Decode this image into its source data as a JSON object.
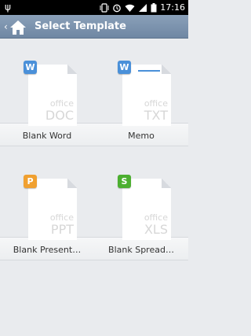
{
  "status_bar": {
    "usb_icon": "usb-debug-icon",
    "time": "17:16"
  },
  "action_bar": {
    "title": "Select Template",
    "home_icon": "home-icon",
    "back_icon": "chevron-left-icon"
  },
  "templates": [
    {
      "label": "Blank Word",
      "badge": "W",
      "badge_color": "#4a90d9",
      "office": "office",
      "ext": "DOC",
      "show_line": false
    },
    {
      "label": "Memo",
      "badge": "W",
      "badge_color": "#4a90d9",
      "office": "office",
      "ext": "TXT",
      "show_line": true
    },
    {
      "label": "Blank Present…",
      "badge": "P",
      "badge_color": "#f0a030",
      "office": "office",
      "ext": "PPT",
      "show_line": false
    },
    {
      "label": "Blank Spread…",
      "badge": "S",
      "badge_color": "#4caf30",
      "office": "office",
      "ext": "XLS",
      "show_line": false
    }
  ]
}
